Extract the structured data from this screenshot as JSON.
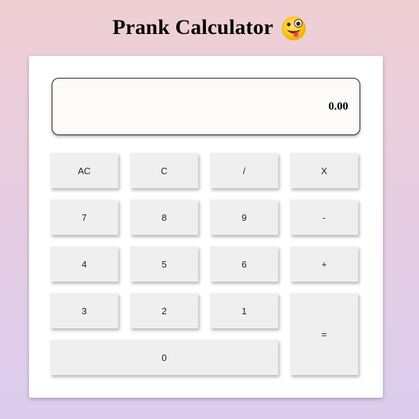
{
  "header": {
    "title": "Prank Calculator",
    "emoji_icon": "zany-face-emoji"
  },
  "display": {
    "value": "0.00"
  },
  "keys": {
    "ac": "AC",
    "c": "C",
    "divide": "/",
    "multiply": "X",
    "seven": "7",
    "eight": "8",
    "nine": "9",
    "minus": "-",
    "four": "4",
    "five": "5",
    "six": "6",
    "plus": "+",
    "three": "3",
    "two": "2",
    "one": "1",
    "equals": "=",
    "zero": "0"
  },
  "colors": {
    "key_background": "#efefef",
    "panel_background": "#ffffff",
    "display_background": "#fdfbf9"
  }
}
